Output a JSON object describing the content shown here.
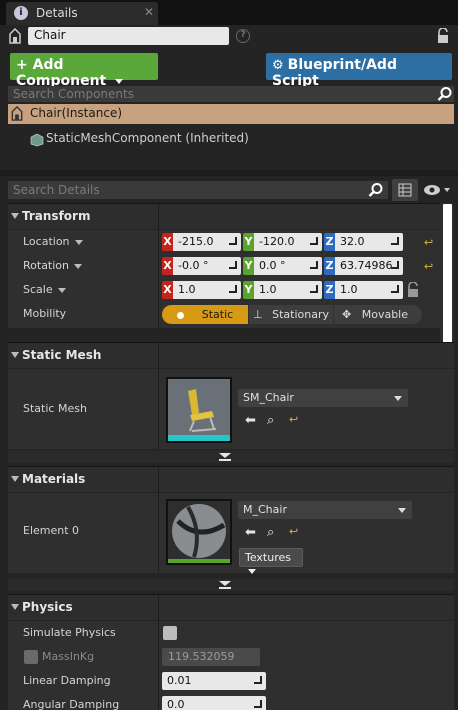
{
  "tab": {
    "title": "Details",
    "close": "✕"
  },
  "header": {
    "actor_name": "Chair",
    "help": "?"
  },
  "buttons": {
    "add_component": "+ Add Component",
    "blueprint": "Blueprint/Add Script"
  },
  "components": {
    "search_placeholder": "Search Components",
    "instance": "Chair(Instance)",
    "child": "StaticMeshComponent (Inherited)"
  },
  "details": {
    "search_placeholder": "Search Details"
  },
  "transform": {
    "title": "Transform",
    "rows": [
      {
        "label": "Location",
        "x": "-215.0",
        "y": "-120.0",
        "z": "32.0"
      },
      {
        "label": "Rotation",
        "x": "-0.0 °",
        "y": "0.0 °",
        "z": "63.74986"
      },
      {
        "label": "Scale",
        "x": "1.0",
        "y": "1.0",
        "z": "1.0"
      }
    ],
    "axis": {
      "x": "X",
      "y": "Y",
      "z": "Z"
    },
    "mobility": {
      "label": "Mobility",
      "options": [
        "Static",
        "Stationary",
        "Movable"
      ],
      "selected": "Static"
    }
  },
  "static_mesh": {
    "title": "Static Mesh",
    "label": "Static Mesh",
    "asset": "SM_Chair"
  },
  "materials": {
    "title": "Materials",
    "label": "Element 0",
    "asset": "M_Chair",
    "textures_btn": "Textures"
  },
  "physics": {
    "title": "Physics",
    "simulate_label": "Simulate Physics",
    "mass_label": "MassInKg",
    "mass_value": "119.532059",
    "linear_label": "Linear Damping",
    "linear_value": "0.01",
    "angular_label": "Angular Damping",
    "angular_value": "0.0"
  },
  "colors": {
    "accent_add": "#5aa73a",
    "accent_bp": "#2d6ea3",
    "selection": "#c8a27f",
    "mobility_active": "#d79a14"
  }
}
